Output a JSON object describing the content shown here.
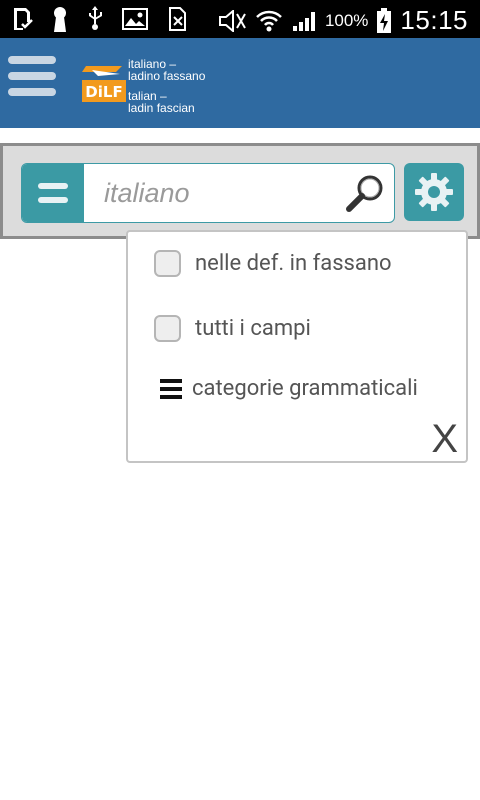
{
  "status_bar": {
    "battery_percent": "100%",
    "time": "15:15",
    "icons": [
      "download-done-icon",
      "keyhole-icon",
      "usb-icon",
      "image-icon",
      "no-sim-icon",
      "mute-icon",
      "wifi-icon",
      "signal-icon",
      "battery-charging-icon"
    ]
  },
  "header": {
    "logo_text": "DiLF",
    "brand_line1": "italiano –",
    "brand_line2": "ladino fassano",
    "brand_line3": "talian –",
    "brand_line4": "ladin fascian"
  },
  "search": {
    "placeholder": "italiano"
  },
  "options_popup": {
    "option1_label": "nelle def. in fassano",
    "option2_label": "tutti i campi",
    "option3_label": "categorie grammaticali",
    "close_label": "X"
  },
  "colors": {
    "header_bg": "#2f6aa1",
    "accent_teal": "#3b9aa4",
    "logo_orange": "#f29a1e"
  }
}
